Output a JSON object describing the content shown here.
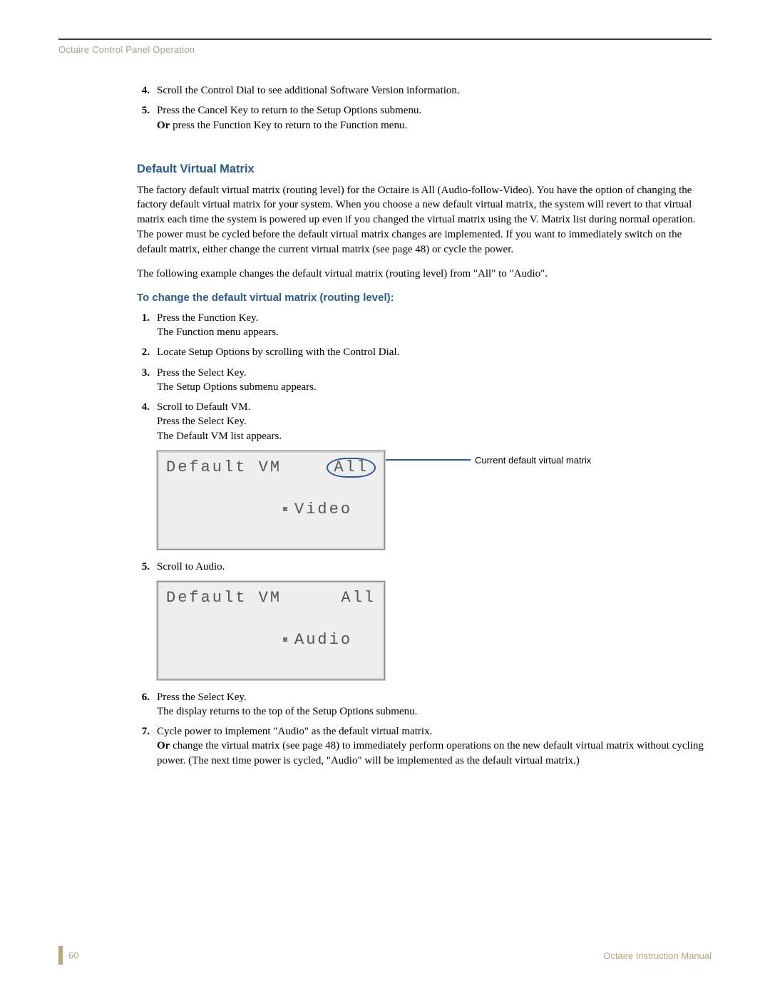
{
  "header": {
    "running": "Octaire Control Panel Operation"
  },
  "topSteps": [
    {
      "n": "4.",
      "text": "Scroll the Control Dial to see additional Software Version information."
    },
    {
      "n": "5.",
      "text": "Press the Cancel Key to return to the Setup Options submenu.",
      "cont_bold": "Or",
      "cont": " press the Function Key to return to the Function menu."
    }
  ],
  "section": {
    "title": "Default Virtual Matrix",
    "p1": "The factory default virtual matrix (routing level) for the Octaire is All (Audio-follow-Video). You have the option of changing the factory default virtual matrix for your system. When you choose a new default virtual matrix, the system will revert to that virtual matrix each time the system is powered up even if you changed the virtual matrix using the V. Matrix list during normal operation. The power must be cycled before the default virtual matrix changes are implemented. If you want to immediately switch on the default matrix, either change the current virtual matrix (see page 48) or cycle the power.",
    "p2": "The following example changes the default virtual matrix (routing level) from \"All\" to \"Audio\".",
    "subhead": "To change the default virtual matrix (routing level):"
  },
  "stepsA": [
    {
      "n": "1.",
      "l1": "Press the Function Key.",
      "l2": "The Function menu appears."
    },
    {
      "n": "2.",
      "l1": "Locate Setup Options by scrolling with the Control Dial."
    },
    {
      "n": "3.",
      "l1": "Press the Select Key.",
      "l2": "The Setup Options submenu appears."
    },
    {
      "n": "4.",
      "l1": "Scroll to Default VM.",
      "l2": "Press the Select Key.",
      "l3": "The Default VM list appears."
    }
  ],
  "lcd1": {
    "top_label": "Default VM",
    "top_value": "All",
    "second_prefix_bullet": true,
    "second": "Video",
    "callout": "Current default virtual matrix"
  },
  "step5": {
    "n": "5.",
    "text": "Scroll to Audio."
  },
  "lcd2": {
    "top_label": "Default VM",
    "top_value": "All",
    "second": "Audio"
  },
  "stepsB": [
    {
      "n": "6.",
      "l1": "Press the Select Key.",
      "l2": "The display returns to the top of the Setup Options submenu."
    },
    {
      "n": "7.",
      "l1": "Cycle power to implement \"Audio\" as the default virtual matrix.",
      "cont_bold": "Or",
      "cont": " change the virtual matrix (see page 48) to immediately perform operations on the new default virtual matrix without cycling power. (The next time power is cycled, \"Audio\" will be implemented as the default virtual matrix.)"
    }
  ],
  "footer": {
    "page": "60",
    "right": "Octaire Instruction Manual"
  }
}
